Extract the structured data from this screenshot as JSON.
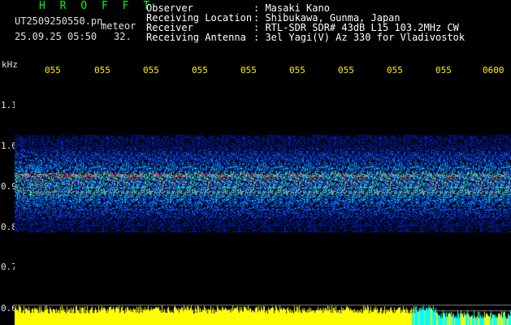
{
  "header": {
    "brand": "H R O F F T",
    "filename": "UT2509250550.pn",
    "meteor_label": "meteor",
    "datetime": "25.09.25 05:50",
    "rate": "32",
    "rate_suffix": "."
  },
  "info": [
    {
      "label": "Observer",
      "value": ": Masaki Kano"
    },
    {
      "label": "Receiving Location",
      "value": ": Shibukawa, Gunma, Japan"
    },
    {
      "label": "Receiver",
      "value": ": RTL-SDR SDR# 43dB L15 103.2MHz CW"
    },
    {
      "label": "Receiving Antenna",
      "value": ": 3el Yagi(V) Az 330 for Vladivostok"
    }
  ],
  "axes": {
    "y_unit": "kHz",
    "y_ticks": [
      "1.1",
      "1.0",
      "0.9",
      "0.8",
      "0.7",
      "0.6"
    ],
    "x_ticks": [
      "055",
      "055",
      "055",
      "055",
      "055",
      "055",
      "055",
      "055",
      "055",
      "0600"
    ]
  },
  "colors": {
    "text_green": "#00ff00",
    "tick_yellow": "#ffee00",
    "background": "#000000",
    "bar_yellow": "#ffff00",
    "bar_cyan": "#00ffff"
  },
  "spectrogram": {
    "band_top_khz": 1.03,
    "band_bottom_khz": 0.79,
    "strong_line_khz": 0.93,
    "second_line_khz": 0.89
  }
}
